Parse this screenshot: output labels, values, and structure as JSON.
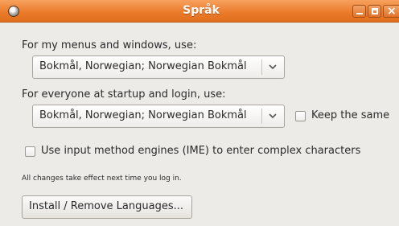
{
  "window": {
    "title": "Språk"
  },
  "menus_section": {
    "label": "For my menus and windows, use:",
    "selected_language": "Bokmål, Norwegian; Norwegian Bokmål"
  },
  "startup_section": {
    "label": "For everyone at startup and login, use:",
    "selected_language": "Bokmål, Norwegian; Norwegian Bokmål",
    "keep_same_label": "Keep the same",
    "keep_same_checked": false
  },
  "ime": {
    "label": "Use input method engines (IME) to enter complex characters",
    "checked": false
  },
  "note": "All changes take effect next time you log in.",
  "install_button": {
    "label": "Install / Remove Languages..."
  },
  "colors": {
    "titlebar": "#ec7c2c",
    "window_bg": "#edebe8"
  }
}
